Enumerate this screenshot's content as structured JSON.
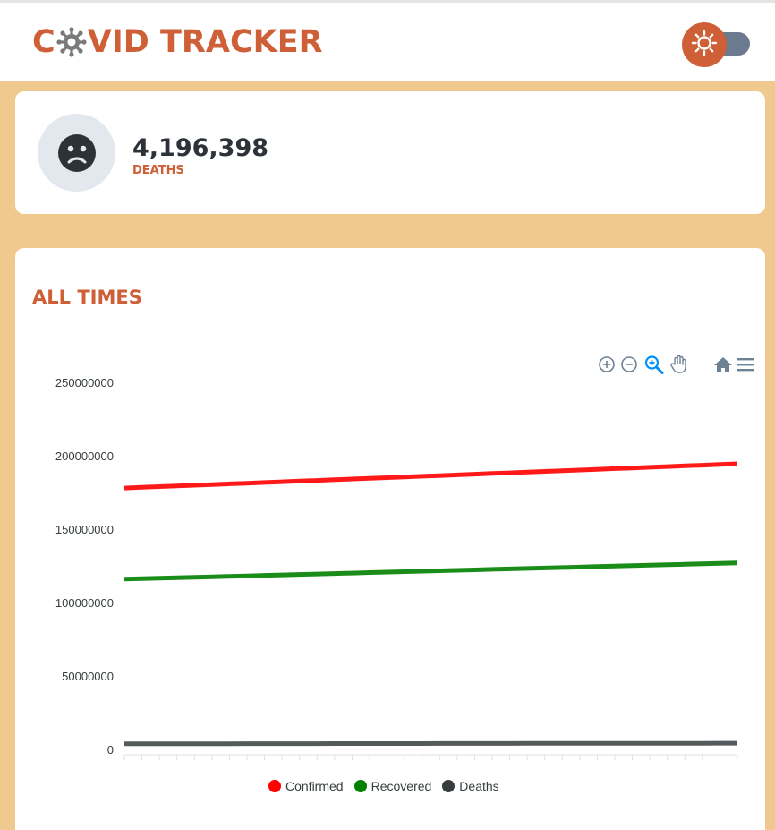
{
  "header": {
    "logo_prefix": "C",
    "logo_suffix": "VID TRACKER",
    "theme_toggle_icon": "sun-icon"
  },
  "colors": {
    "brand": "#cf5f37",
    "page_background": "#efc98e",
    "toggle_track": "#6b7a8e"
  },
  "stat": {
    "icon": "sad-face-icon",
    "value": "4,196,398",
    "label": "DEATHS"
  },
  "chart_section": {
    "title": "ALL TIMES",
    "toolbar": [
      "zoom-in-icon",
      "zoom-out-icon",
      "selection-zoom-icon",
      "pan-icon",
      "reset-zoom-home-icon",
      "menu-icon"
    ]
  },
  "chart_data": {
    "type": "line",
    "title": "",
    "xlabel": "",
    "ylabel": "",
    "ylim": [
      0,
      250000000
    ],
    "yticks": [
      "250000000",
      "200000000",
      "150000000",
      "100000000",
      "50000000",
      "0"
    ],
    "x_points": 36,
    "legend_position": "bottom",
    "series": [
      {
        "name": "Confirmed",
        "color": "#ff0000",
        "start": 178000000,
        "end": 194500000
      },
      {
        "name": "Recovered",
        "color": "#008000",
        "start": 116000000,
        "end": 127000000
      },
      {
        "name": "Deaths",
        "color": "#373d3f",
        "start": 3800000,
        "end": 4196398
      }
    ]
  }
}
